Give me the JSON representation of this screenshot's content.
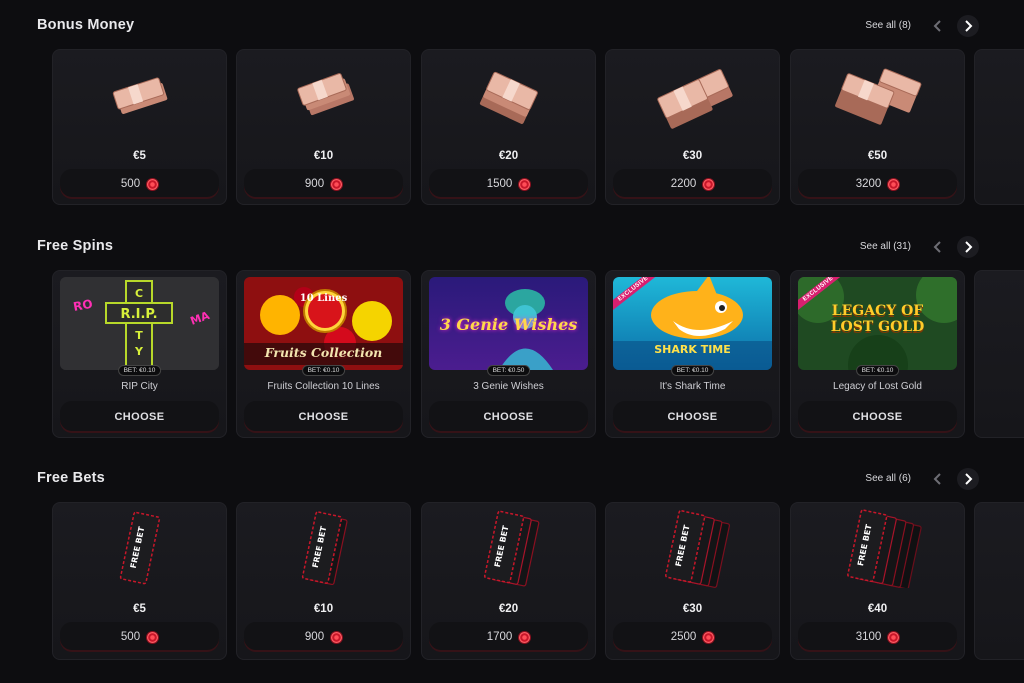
{
  "colors": {
    "background": "#0d0d10",
    "card": "#1a1a1f",
    "accent_red": "#d11a2a",
    "exclusive_pink": "#d81f6f"
  },
  "sections": {
    "bonus": {
      "title": "Bonus Money",
      "see_all": "See all (8)",
      "items": [
        {
          "amount": "€5",
          "price": "500",
          "icon": "cash-stack-icon"
        },
        {
          "amount": "€10",
          "price": "900",
          "icon": "cash-stack-icon"
        },
        {
          "amount": "€20",
          "price": "1500",
          "icon": "cash-stack-icon"
        },
        {
          "amount": "€30",
          "price": "2200",
          "icon": "cash-stack-icon"
        },
        {
          "amount": "€50",
          "price": "3200",
          "icon": "cash-stack-icon"
        }
      ]
    },
    "spins": {
      "title": "Free Spins",
      "see_all": "See all (31)",
      "choose_label": "CHOOSE",
      "exclusive_label": "EXCLUSIVE",
      "items": [
        {
          "name": "RIP City",
          "bet": "BET: €0.10",
          "art": "R.I.P. CITY"
        },
        {
          "name": "Fruits Collection 10 Lines",
          "bet": "BET: €0.10",
          "art": "Fruits Collection",
          "art_badge": "10 Lines"
        },
        {
          "name": "3 Genie Wishes",
          "bet": "BET: €0.50",
          "art": "3 Genie Wishes"
        },
        {
          "name": "It's Shark Time",
          "bet": "BET: €0.10",
          "art": "SHARK TIME"
        },
        {
          "name": "Legacy of Lost Gold",
          "bet": "BET: €0.10",
          "art": "LEGACY OF LOST GOLD"
        }
      ]
    },
    "bets": {
      "title": "Free Bets",
      "see_all": "See all (6)",
      "ticket_label": "FREE BET",
      "items": [
        {
          "amount": "€5",
          "price": "500",
          "icon": "free-bet-ticket-icon"
        },
        {
          "amount": "€10",
          "price": "900",
          "icon": "free-bet-ticket-icon"
        },
        {
          "amount": "€20",
          "price": "1700",
          "icon": "free-bet-ticket-icon"
        },
        {
          "amount": "€30",
          "price": "2500",
          "icon": "free-bet-ticket-icon"
        },
        {
          "amount": "€40",
          "price": "3100",
          "icon": "free-bet-ticket-icon"
        }
      ]
    }
  }
}
